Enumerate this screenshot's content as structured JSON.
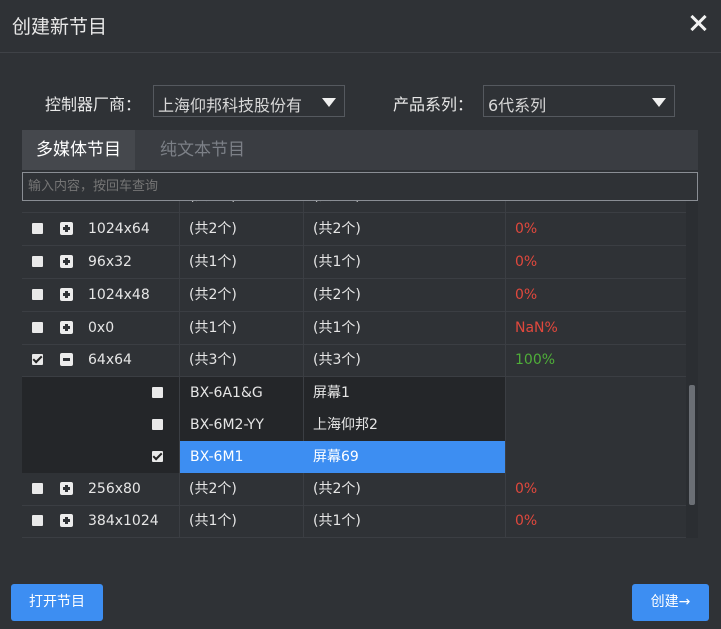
{
  "dialog": {
    "title": "创建新节目"
  },
  "filters": {
    "manufacturer_label": "控制器厂商：",
    "manufacturer_value": "上海仰邦科技股份有",
    "series_label": "产品系列：",
    "series_value": "6代系列"
  },
  "tabs": {
    "multimedia": "多媒体节目",
    "text": "纯文本节目"
  },
  "search": {
    "placeholder": "输入内容，按回车查询"
  },
  "table": {
    "partial_top": {
      "c2": "(共2个)",
      "c3": "(共2个)"
    },
    "rows": [
      {
        "name": "1024x64",
        "c2": "(共2个)",
        "c3": "(共2个)",
        "pct": "0%",
        "checked": false,
        "expanded": false,
        "pct_color": "#e0483d"
      },
      {
        "name": "96x32",
        "c2": "(共1个)",
        "c3": "(共1个)",
        "pct": "0%",
        "checked": false,
        "expanded": false,
        "pct_color": "#e0483d"
      },
      {
        "name": "1024x48",
        "c2": "(共2个)",
        "c3": "(共2个)",
        "pct": "0%",
        "checked": false,
        "expanded": false,
        "pct_color": "#e0483d"
      },
      {
        "name": "0x0",
        "c2": "(共1个)",
        "c3": "(共1个)",
        "pct": "NaN%",
        "checked": false,
        "expanded": false,
        "pct_color": "#e0483d"
      },
      {
        "name": "64x64",
        "c2": "(共3个)",
        "c3": "(共3个)",
        "pct": "100%",
        "checked": true,
        "expanded": true,
        "pct_color": "#4fae39"
      }
    ],
    "subrows": [
      {
        "model": "BX-6A1&G",
        "screen": "屏幕1",
        "checked": false
      },
      {
        "model": "BX-6M2-YY",
        "screen": "上海仰邦2",
        "checked": false
      },
      {
        "model": "BX-6M1",
        "screen": "屏幕69",
        "checked": true
      }
    ],
    "rows_after": [
      {
        "name": "256x80",
        "c2": "(共2个)",
        "c3": "(共2个)",
        "pct": "0%",
        "checked": false,
        "expanded": false,
        "pct_color": "#e0483d"
      },
      {
        "name": "384x1024",
        "c2": "(共1个)",
        "c3": "(共1个)",
        "pct": "0%",
        "checked": false,
        "expanded": false,
        "pct_color": "#e0483d"
      }
    ]
  },
  "footer": {
    "open_label": "打开节目",
    "create_label": "创建→"
  }
}
